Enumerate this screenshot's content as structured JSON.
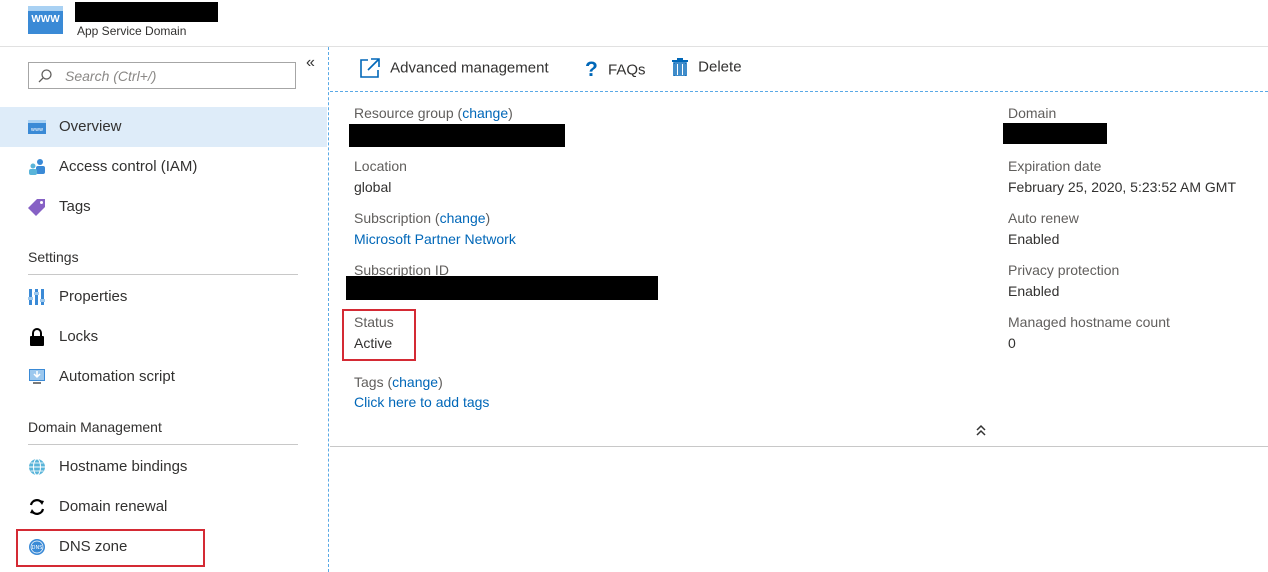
{
  "header": {
    "icon_text": "WWW",
    "subtitle": "App Service Domain"
  },
  "sidebar": {
    "search_placeholder": "Search (Ctrl+/)",
    "collapse_glyph": "«",
    "items": [
      {
        "label": "Overview",
        "icon": "www-icon",
        "selected": true
      },
      {
        "label": "Access control (IAM)",
        "icon": "people-icon"
      },
      {
        "label": "Tags",
        "icon": "tag-icon"
      }
    ],
    "settings": {
      "title": "Settings",
      "items": [
        {
          "label": "Properties",
          "icon": "properties-icon"
        },
        {
          "label": "Locks",
          "icon": "lock-icon"
        },
        {
          "label": "Automation script",
          "icon": "script-icon"
        }
      ]
    },
    "domain_management": {
      "title": "Domain Management",
      "items": [
        {
          "label": "Hostname bindings",
          "icon": "globe-icon"
        },
        {
          "label": "Domain renewal",
          "icon": "refresh-icon"
        },
        {
          "label": "DNS zone",
          "icon": "dns-icon"
        }
      ]
    }
  },
  "toolbar": {
    "advanced": "Advanced management",
    "faqs": "FAQs",
    "delete": "Delete"
  },
  "essentials": {
    "left": {
      "resource_group_label": "Resource group",
      "change": "change",
      "location_label": "Location",
      "location_value": "global",
      "subscription_label": "Subscription",
      "subscription_value": "Microsoft Partner Network",
      "subscription_id_label": "Subscription ID",
      "status_label": "Status",
      "status_value": "Active",
      "tags_label": "Tags",
      "tags_value": "Click here to add tags"
    },
    "right": {
      "domain_label": "Domain",
      "expiration_label": "Expiration date",
      "expiration_value": "February 25, 2020, 5:23:52 AM GMT",
      "auto_renew_label": "Auto renew",
      "auto_renew_value": "Enabled",
      "privacy_label": "Privacy protection",
      "privacy_value": "Enabled",
      "hostname_count_label": "Managed hostname count",
      "hostname_count_value": "0"
    },
    "collapse_glyph": "⌃"
  },
  "colors": {
    "accent": "#0067b8",
    "selected_bg": "#deecf9",
    "highlight": "#d42a34"
  }
}
